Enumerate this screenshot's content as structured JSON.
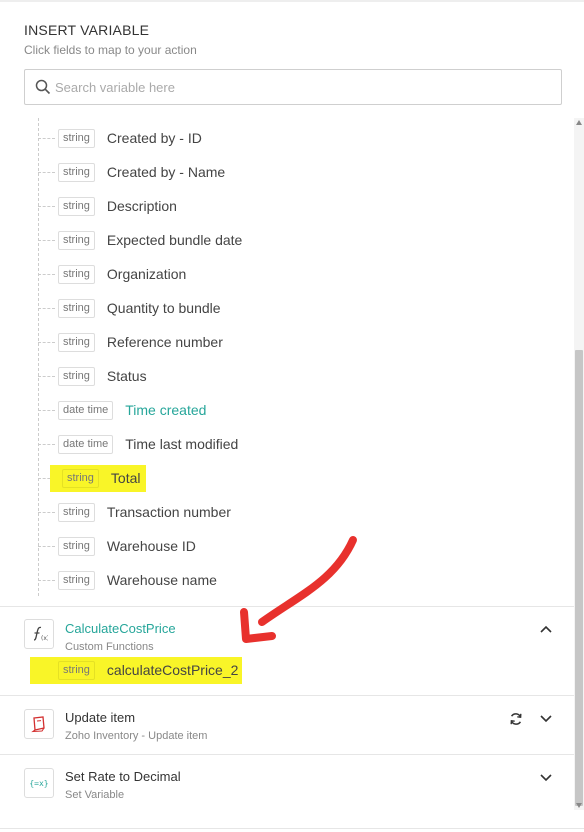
{
  "header": {
    "title": "INSERT VARIABLE",
    "subtitle": "Click fields to map to your action"
  },
  "search": {
    "placeholder": "Search variable here"
  },
  "fields": [
    {
      "type": "string",
      "label": "Created by - ID"
    },
    {
      "type": "string",
      "label": "Created by - Name"
    },
    {
      "type": "string",
      "label": "Description"
    },
    {
      "type": "string",
      "label": "Expected bundle date"
    },
    {
      "type": "string",
      "label": "Organization"
    },
    {
      "type": "string",
      "label": "Quantity to bundle"
    },
    {
      "type": "string",
      "label": "Reference number"
    },
    {
      "type": "string",
      "label": "Status"
    },
    {
      "type": "date time",
      "label": "Time created"
    },
    {
      "type": "date time",
      "label": "Time last modified"
    },
    {
      "type": "string",
      "label": "Total"
    },
    {
      "type": "string",
      "label": "Transaction number"
    },
    {
      "type": "string",
      "label": "Warehouse ID"
    },
    {
      "type": "string",
      "label": "Warehouse name"
    }
  ],
  "sections": [
    {
      "title": "CalculateCostPrice",
      "subtitle": "Custom Functions",
      "icon": "function-icon",
      "expanded": true,
      "fields": [
        {
          "type": "string",
          "label": "calculateCostPrice_2"
        }
      ]
    },
    {
      "title": "Update item",
      "subtitle": "Zoho Inventory - Update item",
      "icon": "book-icon",
      "expanded": false
    },
    {
      "title": "Set Rate to Decimal",
      "subtitle": "Set Variable",
      "icon": "variable-icon",
      "expanded": false
    }
  ],
  "colors": {
    "accent": "#26a69a",
    "highlight": "#f9f528",
    "annotation": "#e8312d"
  }
}
